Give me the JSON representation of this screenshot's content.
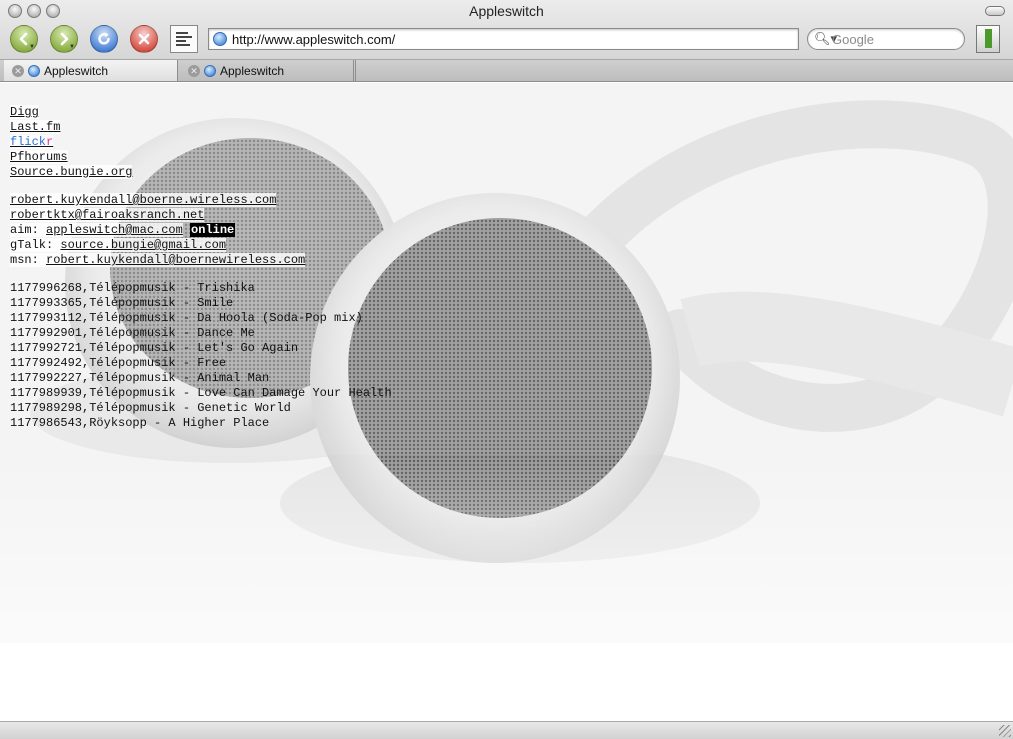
{
  "window": {
    "title": "Appleswitch"
  },
  "toolbar": {
    "back_icon": "back-arrow-icon",
    "forward_icon": "forward-arrow-icon",
    "reload_icon": "reload-icon",
    "stop_icon": "stop-x-icon",
    "url": "http://www.appleswitch.com/",
    "search_placeholder": "Google"
  },
  "tabs": [
    {
      "label": "Appleswitch",
      "active": true
    },
    {
      "label": "Appleswitch",
      "active": false
    }
  ],
  "page": {
    "links": [
      "Digg",
      "Last.fm",
      "Pfhorums",
      "Source.bungie.org"
    ],
    "flickr": {
      "part1": "flick",
      "part2": "r"
    },
    "contacts": {
      "email1": "robert.kuykendall@boerne.wireless.com",
      "email2": "robertktx@fairoaksranch.net",
      "aim_label": "aim: ",
      "aim": "appleswitch@mac.com",
      "aim_status": "online",
      "gtalk_label": "gTalk: ",
      "gtalk": "source.bungie@gmail.com",
      "msn_label": "msn: ",
      "msn": "robert.kuykendall@boernewireless.com"
    },
    "tracks": [
      "1177996268,Télépopmusik - Trishika",
      "1177993365,Télépopmusik - Smile",
      "1177993112,Télépopmusik - Da Hoola (Soda-Pop mix)",
      "1177992901,Télépopmusik - Dance Me",
      "1177992721,Télépopmusik - Let's Go Again",
      "1177992492,Télépopmusik - Free",
      "1177992227,Télépopmusik - Animal Man",
      "1177989939,Télépopmusik - Love Can Damage Your Health",
      "1177989298,Télépopmusik - Genetic World",
      "1177986543,Röyksopp - A Higher Place"
    ]
  },
  "colors": {
    "flickr_blue": "#2d6fd6",
    "flickr_pink": "#e2318c",
    "status_bg": "#000000"
  }
}
